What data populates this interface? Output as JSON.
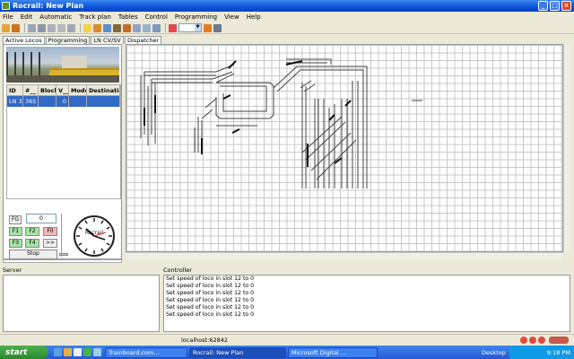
{
  "window": {
    "title": "Rocrail: New Plan"
  },
  "menu": [
    "File",
    "Edit",
    "Automatic",
    "Track plan",
    "Tables",
    "Control",
    "Programming",
    "View",
    "Help"
  ],
  "left_tabs": [
    {
      "label": "Active Locos",
      "active": true
    },
    {
      "label": "Programming",
      "active": false
    },
    {
      "label": "LN CV/SV",
      "active": false
    }
  ],
  "loco_table": {
    "headers": [
      "ID",
      "#__",
      "Block",
      "V__",
      "Mode",
      "Destinatio"
    ],
    "rows": [
      [
        "LN 365",
        "365",
        "",
        "0",
        "",
        ""
      ]
    ]
  },
  "controls": {
    "fg_label": "FG",
    "speed_value": "0",
    "f1": "F1",
    "f2": "F2",
    "f0": "F0",
    "f3": "F3",
    "f4": "F4",
    "more": ">>",
    "stop": "Stop",
    "clock_label": "Rocrail"
  },
  "dispatcher_tab": "Dispatcher",
  "server": {
    "title": "Server"
  },
  "controller": {
    "title": "Controller",
    "lines": [
      "Set speed of loco in slot 12 to 0",
      "Set speed of loco in slot 12 to 0",
      "Set speed of loco in slot 12 to 0",
      "Set speed of loco in slot 12 to 0",
      "Set speed of loco in slot 12 to 0",
      "Set speed of loco in slot 12 to 0"
    ]
  },
  "status_bar": {
    "host": "localhost:62842"
  },
  "taskbar": {
    "start": "start",
    "tasks": [
      {
        "label": "Trainboard.com...",
        "active": false
      },
      {
        "label": "Rocrail: New Plan",
        "active": true
      },
      {
        "label": "Microsoft Digital ...",
        "active": false
      }
    ],
    "desktop": "Desktop",
    "time": "9:18 PM"
  },
  "colors": {
    "titlebar": "#0a54d8",
    "selection": "#3169c6",
    "track": "#444444"
  }
}
